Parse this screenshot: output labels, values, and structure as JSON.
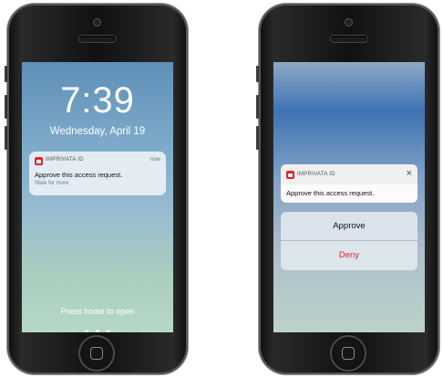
{
  "lock_screen": {
    "time": "7:39",
    "date": "Wednesday, April 19",
    "notification": {
      "app_name": "IMPRIVATA ID",
      "time_label": "now",
      "title": "Approve this access request.",
      "subtitle": "Slide for more"
    },
    "footer_hint": "Press home to open"
  },
  "expanded_notification": {
    "app_name": "IMPRIVATA ID",
    "close_icon": "×",
    "message": "Approve this access request.",
    "actions": {
      "approve_label": "Approve",
      "deny_label": "Deny"
    }
  },
  "colors": {
    "accent_red": "#e0262b"
  }
}
